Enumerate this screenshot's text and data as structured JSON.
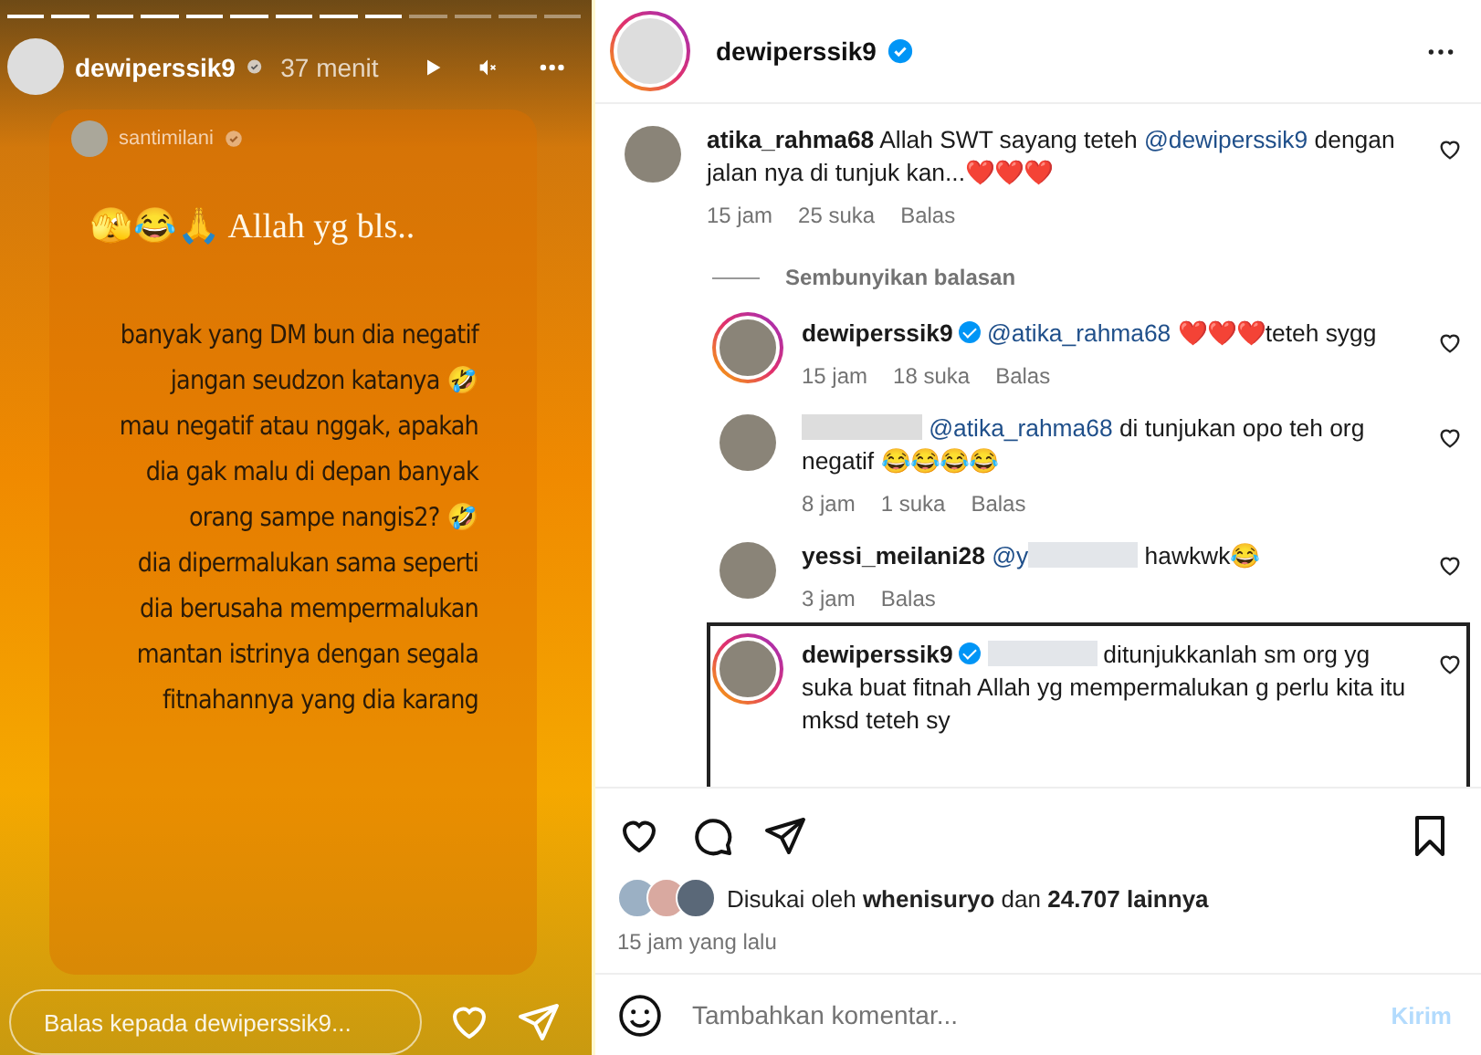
{
  "story": {
    "progress": [
      {
        "viewed": true
      },
      {
        "viewed": true
      },
      {
        "viewed": true
      },
      {
        "viewed": true
      },
      {
        "viewed": true
      },
      {
        "viewed": true
      },
      {
        "viewed": true
      },
      {
        "viewed": true
      },
      {
        "viewed": true
      },
      {
        "viewed": false
      },
      {
        "viewed": false
      },
      {
        "viewed": false
      },
      {
        "viewed": false
      }
    ],
    "username": "dewiperssik9",
    "verified": true,
    "time": "37 menit",
    "shared_post": {
      "username": "santimilani",
      "verified": true,
      "title": "🫣😂🙏 Allah yg bls..",
      "lines": [
        "banyak yang DM bun dia negatif",
        "jangan seudzon katanya 🤣",
        "mau negatif atau nggak, apakah",
        "dia gak malu  di depan banyak",
        "orang  sampe nangis2? 🤣",
        "dia dipermalukan sama seperti",
        "dia berusaha mempermalukan",
        "mantan istrinya dengan segala",
        "fitnahannya yang dia karang"
      ]
    },
    "reply_field": {
      "placeholder": "Balas kepada dewiperssik9..."
    }
  },
  "post": {
    "username": "dewiperssik9",
    "verified": true,
    "comments": [
      {
        "username": "atika_rahma68",
        "author_redacted": false,
        "verified": false,
        "story_ring": false,
        "selected": false,
        "parts": [
          {
            "kind": "text",
            "text": "Allah SWT sayang teteh "
          },
          {
            "kind": "mention",
            "text": "@dewiperssik9"
          },
          {
            "kind": "text",
            "text": " dengan jalan nya di tunjuk kan...❤️❤️❤️"
          }
        ],
        "time": "15 jam",
        "likes": "25 suka",
        "reply_label": "Balas",
        "toggle_label": "Sembunyikan balasan",
        "children": [
          {
            "username": "dewiperssik9",
            "author_redacted": false,
            "verified": true,
            "story_ring": true,
            "selected": false,
            "parts": [
              {
                "kind": "mention",
                "text": "@atika_rahma68"
              },
              {
                "kind": "text",
                "text": " ❤️❤️❤️teteh sygg"
              }
            ],
            "time": "15 jam",
            "likes": "18 suka",
            "reply_label": "Balas"
          },
          {
            "author_redacted": true,
            "verified": false,
            "story_ring": false,
            "selected": false,
            "parts": [
              {
                "kind": "mention",
                "text": "@atika_rahma68"
              },
              {
                "kind": "text",
                "text": " di tunjukan opo teh org negatif 😂😂😂😂"
              }
            ],
            "time": "8 jam",
            "likes": "1 suka",
            "reply_label": "Balas"
          },
          {
            "username": "yessi_meilani28",
            "author_redacted": false,
            "verified": false,
            "story_ring": false,
            "selected": false,
            "parts": [
              {
                "kind": "mention",
                "text": "@y"
              },
              {
                "kind": "redacted"
              },
              {
                "kind": "text",
                "text": " hawkwk😂"
              }
            ],
            "time": "3 jam",
            "reply_label": "Balas"
          },
          {
            "username": "dewiperssik9",
            "author_redacted": false,
            "verified": true,
            "story_ring": true,
            "selected": true,
            "parts": [
              {
                "kind": "redacted"
              },
              {
                "kind": "text",
                "text": " ditunjukkanlah sm org yg suka buat fitnah Allah yg mempermalukan g perlu kita itu mksd teteh sy"
              }
            ]
          }
        ]
      }
    ],
    "liked_by": "Disukai oleh **whenisuryo** dan **24.707 lainnya**",
    "time": "15 jam yang lalu",
    "comment_field": {
      "placeholder": "Tambahkan komentar..."
    },
    "submit": "Kirim"
  }
}
